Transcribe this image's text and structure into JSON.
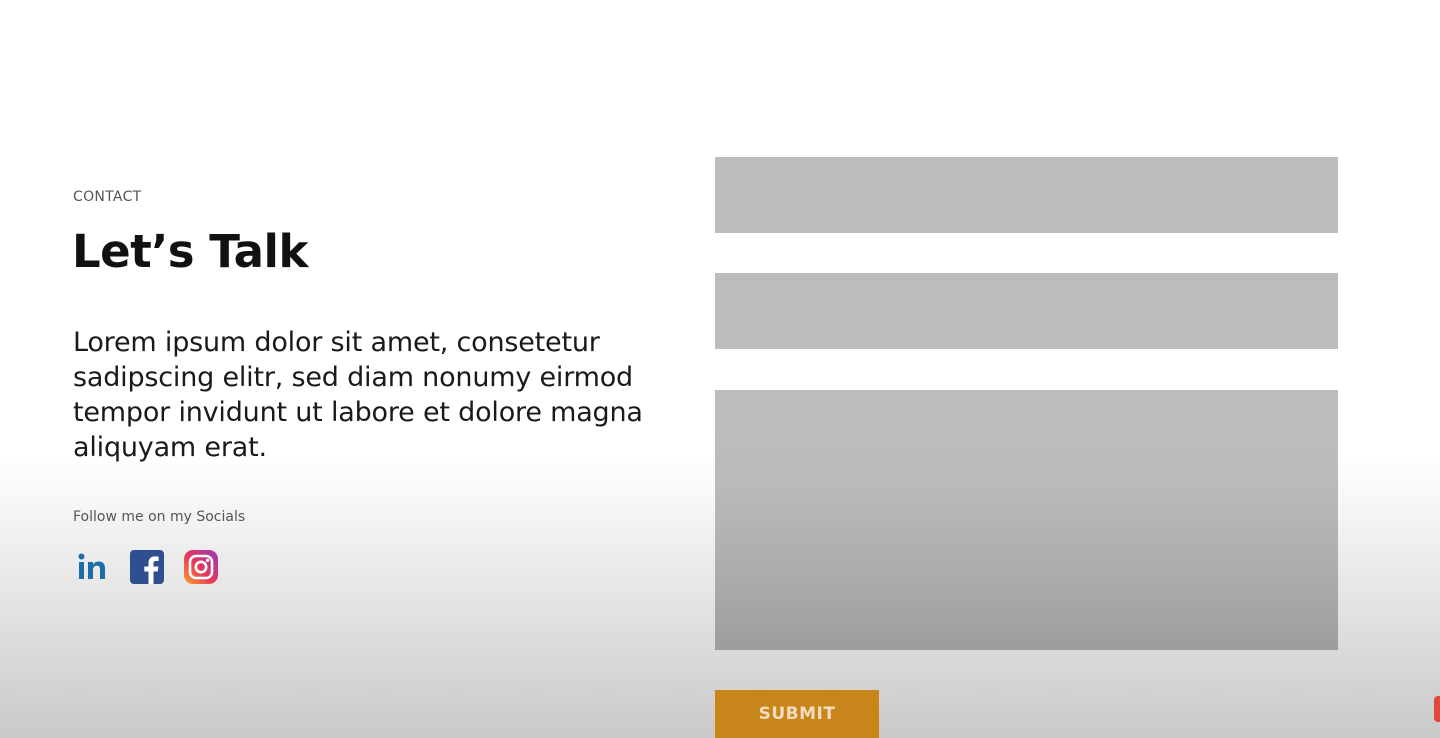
{
  "contact": {
    "eyebrow": "CONTACT",
    "headline": "Let’s Talk",
    "body": "Lorem ipsum dolor sit amet, consetetur sadipscing elitr, sed diam nonumy eirmod tempor invidunt ut labore et dolore magna aliquyam erat.",
    "follow_label": "Follow me on my Socials",
    "socials": [
      {
        "icon": "linkedin-icon",
        "label": "in",
        "color": "#1b6fa8"
      },
      {
        "icon": "facebook-icon",
        "label": "f",
        "color": "#3b5998"
      },
      {
        "icon": "instagram-icon",
        "color": "#d6297b"
      }
    ]
  },
  "form": {
    "name_value": "",
    "email_value": "",
    "message_value": "",
    "submit_label": "SUBMIT",
    "field_color": "#bcbcbc",
    "submit_color": "#c8861a"
  }
}
